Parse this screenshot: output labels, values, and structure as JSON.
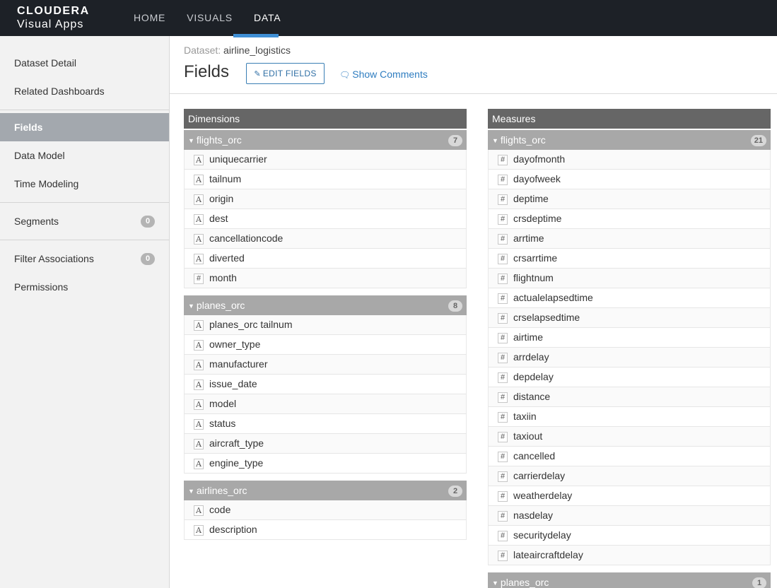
{
  "header": {
    "logo_top": "CLOUDERA",
    "logo_bottom": "Visual Apps",
    "nav": [
      "HOME",
      "VISUALS",
      "DATA"
    ]
  },
  "sidebar": {
    "dataset_detail": "Dataset Detail",
    "related_dashboards": "Related Dashboards",
    "fields": "Fields",
    "data_model": "Data Model",
    "time_modeling": "Time Modeling",
    "segments": "Segments",
    "segments_count": "0",
    "filter_associations": "Filter Associations",
    "filter_associations_count": "0",
    "permissions": "Permissions"
  },
  "page": {
    "dataset_label": "Dataset:",
    "dataset_name": "airline_logistics",
    "title": "Fields",
    "edit_button": "EDIT FIELDS",
    "show_comments": "Show Comments"
  },
  "dimensions": {
    "title": "Dimensions",
    "sections": [
      {
        "name": "flights_orc",
        "count": "7",
        "fields": [
          {
            "type": "A",
            "name": "uniquecarrier"
          },
          {
            "type": "A",
            "name": "tailnum"
          },
          {
            "type": "A",
            "name": "origin"
          },
          {
            "type": "A",
            "name": "dest"
          },
          {
            "type": "A",
            "name": "cancellationcode"
          },
          {
            "type": "A",
            "name": "diverted"
          },
          {
            "type": "#",
            "name": "month"
          }
        ]
      },
      {
        "name": "planes_orc",
        "count": "8",
        "fields": [
          {
            "type": "A",
            "name": "planes_orc tailnum"
          },
          {
            "type": "A",
            "name": "owner_type"
          },
          {
            "type": "A",
            "name": "manufacturer"
          },
          {
            "type": "A",
            "name": "issue_date"
          },
          {
            "type": "A",
            "name": "model"
          },
          {
            "type": "A",
            "name": "status"
          },
          {
            "type": "A",
            "name": "aircraft_type"
          },
          {
            "type": "A",
            "name": "engine_type"
          }
        ]
      },
      {
        "name": "airlines_orc",
        "count": "2",
        "fields": [
          {
            "type": "A",
            "name": "code"
          },
          {
            "type": "A",
            "name": "description"
          }
        ]
      }
    ]
  },
  "measures": {
    "title": "Measures",
    "sections": [
      {
        "name": "flights_orc",
        "count": "21",
        "fields": [
          {
            "type": "#",
            "name": "dayofmonth"
          },
          {
            "type": "#",
            "name": "dayofweek"
          },
          {
            "type": "#",
            "name": "deptime"
          },
          {
            "type": "#",
            "name": "crsdeptime"
          },
          {
            "type": "#",
            "name": "arrtime"
          },
          {
            "type": "#",
            "name": "crsarrtime"
          },
          {
            "type": "#",
            "name": "flightnum"
          },
          {
            "type": "#",
            "name": "actualelapsedtime"
          },
          {
            "type": "#",
            "name": "crselapsedtime"
          },
          {
            "type": "#",
            "name": "airtime"
          },
          {
            "type": "#",
            "name": "arrdelay"
          },
          {
            "type": "#",
            "name": "depdelay"
          },
          {
            "type": "#",
            "name": "distance"
          },
          {
            "type": "#",
            "name": "taxiin"
          },
          {
            "type": "#",
            "name": "taxiout"
          },
          {
            "type": "#",
            "name": "cancelled"
          },
          {
            "type": "#",
            "name": "carrierdelay"
          },
          {
            "type": "#",
            "name": "weatherdelay"
          },
          {
            "type": "#",
            "name": "nasdelay"
          },
          {
            "type": "#",
            "name": "securitydelay"
          },
          {
            "type": "#",
            "name": "lateaircraftdelay"
          }
        ]
      },
      {
        "name": "planes_orc",
        "count": "1",
        "fields": []
      }
    ]
  }
}
